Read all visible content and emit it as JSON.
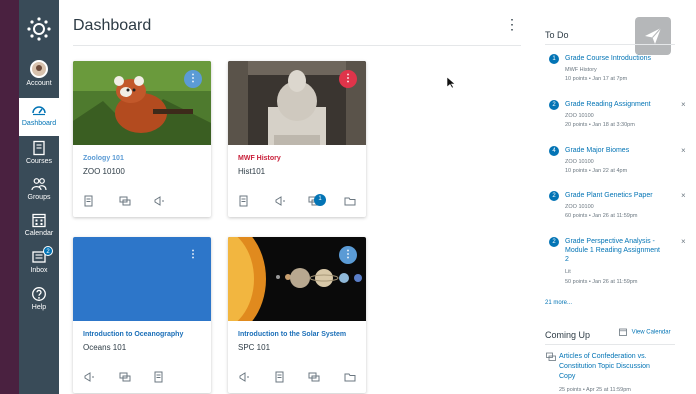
{
  "nav": {
    "account": "Account",
    "dashboard": "Dashboard",
    "courses": "Courses",
    "groups": "Groups",
    "calendar": "Calendar",
    "inbox": "Inbox",
    "inbox_badge": "2",
    "help": "Help"
  },
  "header": {
    "title": "Dashboard",
    "menu_glyph": "⋮"
  },
  "cards": [
    {
      "name": "Zoology 101",
      "code": "ZOO 10100",
      "color": "#5b9bd5",
      "name_color": "#5b9bd5"
    },
    {
      "name": "MWF History",
      "code": "Hist101",
      "color": "#e0344a",
      "name_color": "#c9203a",
      "badge": "1"
    },
    {
      "name": "Introduction to Oceanography",
      "code": "Oceans 101",
      "color": "#2d76c9",
      "name_color": "#1b6fb8"
    },
    {
      "name": "Introduction to the Solar System",
      "code": "SPC 101",
      "color": "#5b9bd5",
      "name_color": "#1b6fb8"
    }
  ],
  "card_menu_glyph": "⋮",
  "todo": {
    "heading": "To Do",
    "items": [
      {
        "num": "1",
        "title": "Grade Course Introductions",
        "course": "MWF History",
        "meta": "10 points • Jan 17 at 7pm"
      },
      {
        "num": "2",
        "title": "Grade Reading Assignment",
        "course": "ZOO 10100",
        "meta": "20 points • Jan 18 at 3:30pm",
        "close": "×"
      },
      {
        "num": "4",
        "title": "Grade Major Biomes",
        "course": "ZOO 10100",
        "meta": "10 points • Jan 22 at 4pm",
        "close": "×"
      },
      {
        "num": "2",
        "title": "Grade Plant Genetics Paper",
        "course": "ZOO 10100",
        "meta": "60 points • Jan 26 at 11:59pm",
        "close": "×"
      },
      {
        "num": "2",
        "title": "Grade Perspective Analysis - Module 1 Reading Assignment 2",
        "course": "Lit",
        "meta": "50 points • Jan 26 at 11:59pm",
        "close": "×"
      }
    ],
    "more": "21 more..."
  },
  "coming_up": {
    "heading": "Coming Up",
    "view_calendar": "View Calendar",
    "items": [
      {
        "title": "Articles of Confederation vs. Constitution Topic Discussion Copy",
        "meta": "25 points • Apr 25 at 11:59pm"
      }
    ]
  },
  "colors": {
    "nav_bg": "#394b58",
    "accent": "#0374b5",
    "frame_bg": "#4a2140"
  }
}
